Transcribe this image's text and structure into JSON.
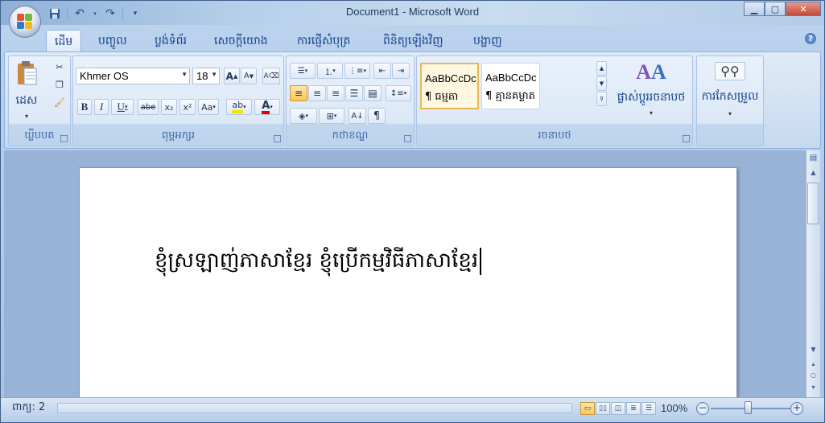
{
  "window": {
    "title": "Document1 - Microsoft Word"
  },
  "qat": {
    "save_icon": "save-icon",
    "undo_icon": "undo-icon",
    "redo_icon": "redo-icon"
  },
  "tabs": [
    {
      "label": "ដើម",
      "active": true
    },
    {
      "label": "បញ្ចូល",
      "active": false
    },
    {
      "label": "ប្លង់ទំព័រ",
      "active": false
    },
    {
      "label": "សេចក្ដីយោង",
      "active": false
    },
    {
      "label": "ការផ្ញើសំបុត្រ",
      "active": false
    },
    {
      "label": "ពិនិត្យឡើងវិញ",
      "active": false
    },
    {
      "label": "បង្ហាញ",
      "active": false
    }
  ],
  "ribbon": {
    "clipboard": {
      "label": "ឃ្លីបបត",
      "paste_label": "ដេស"
    },
    "font": {
      "label": "ពុម្ពអក្សរ",
      "font_name": "Khmer OS",
      "font_size": "18",
      "bold": "B",
      "italic": "I",
      "underline": "U",
      "strikethrough": "abe",
      "subscript": "x₂",
      "superscript": "x²",
      "change_case": "Aa"
    },
    "paragraph": {
      "label": "កថាខណ្ឌ"
    },
    "styles": {
      "label": "រចនាបថ",
      "items": [
        {
          "sample": "AaBbCcDc",
          "name": "¶ ធម្មតា",
          "selected": true
        },
        {
          "sample": "AaBbCcDc",
          "name": "¶ គ្មានគម្លាត",
          "selected": false
        }
      ],
      "change_styles_label": "ផ្លាស់ប្ដូររចនាបថ"
    },
    "editing": {
      "label": "ការកែសម្រួល"
    }
  },
  "document": {
    "text": "ខ្ញុំស្រឡាញ់ភាសាខ្មែរ ខ្ញុំប្រើកម្មវិធីភាសាខ្មែរ"
  },
  "status": {
    "page_label": "ពាក្យ: 2",
    "zoom": "100%"
  },
  "colors": {
    "highlight": "#f2e500",
    "font_color": "#e60000"
  }
}
